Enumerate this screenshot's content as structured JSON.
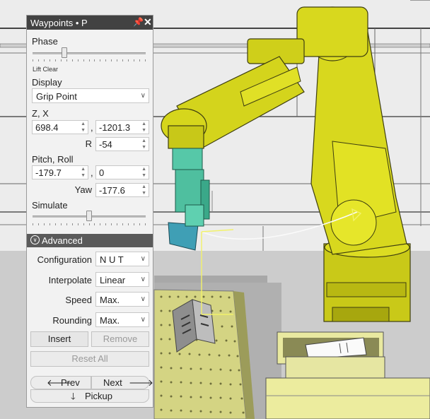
{
  "panel": {
    "title": "Waypoints • P",
    "pin_icon": "pin-icon",
    "close_icon": "close-icon",
    "phase_label": "Phase",
    "phase_value_label": "Lift Clear",
    "phase_level": 0.27,
    "display_label": "Display",
    "display_value": "Grip Point",
    "zx_label": "Z, X",
    "z_value": "698.4",
    "x_value": "-1201.3",
    "comma": ",",
    "r_label": "R",
    "r_value": "-54",
    "pitch_roll_label": "Pitch, Roll",
    "pitch_value": "-179.7",
    "roll_value": "0",
    "yaw_label": "Yaw",
    "yaw_value": "-177.6",
    "simulate_label": "Simulate",
    "simulate_level": 0.5
  },
  "advanced": {
    "header": "Advanced",
    "configuration_label": "Configuration",
    "configuration_value": "N U T",
    "interpolate_label": "Interpolate",
    "interpolate_value": "Linear",
    "speed_label": "Speed",
    "speed_value": "Max.",
    "rounding_label": "Rounding",
    "rounding_value": "Max.",
    "insert_label": "Insert",
    "remove_label": "Remove",
    "reset_label": "Reset All",
    "prev_label": "Prev",
    "next_label": "Next",
    "pickup_label": "Pickup"
  },
  "colors": {
    "robot": "#d8d81e",
    "gripper": "#4fc5a6",
    "path": "#f5f5a0"
  }
}
